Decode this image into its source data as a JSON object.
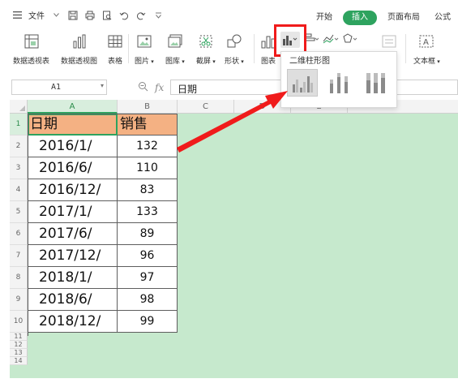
{
  "menu": {
    "file_label": "文件",
    "tabs": [
      {
        "label": "开始",
        "active": false
      },
      {
        "label": "插入",
        "active": true
      },
      {
        "label": "页面布局",
        "active": false
      },
      {
        "label": "公式",
        "active": false
      }
    ]
  },
  "ribbon": {
    "pivot_table": "数据透视表",
    "pivot_chart": "数据透视图",
    "table": "表格",
    "picture": "图片",
    "gallery": "图库",
    "screenshot": "截屏",
    "shapes": "形状",
    "chart": "图表",
    "textbox": "文本框"
  },
  "chart_dropdown": {
    "title": "二维柱形图",
    "options": [
      "clustered-column-icon",
      "stacked-column-icon",
      "percent-stacked-column-icon"
    ],
    "selected_index": 0
  },
  "formula_bar": {
    "cell_ref": "A1",
    "fx_label": "fx",
    "value": "日期"
  },
  "columns": [
    "A",
    "B",
    "C",
    "D",
    "E"
  ],
  "rows": [
    "1",
    "2",
    "3",
    "4",
    "5",
    "6",
    "7",
    "8",
    "9",
    "10",
    "11",
    "12",
    "13",
    "14"
  ],
  "table": {
    "headers": [
      "日期",
      "销售"
    ],
    "rows": [
      [
        "2016/1/",
        "132"
      ],
      [
        "2016/6/",
        "110"
      ],
      [
        "2016/12/",
        "83"
      ],
      [
        "2017/1/",
        "133"
      ],
      [
        "2017/6/",
        "89"
      ],
      [
        "2017/12/",
        "96"
      ],
      [
        "2018/1/",
        "97"
      ],
      [
        "2018/6/",
        "98"
      ],
      [
        "2018/12/",
        "99"
      ]
    ]
  },
  "colors": {
    "sheet_background": "#c6e9cd",
    "header_fill": "#f4b183",
    "active_tab": "#2ea35f",
    "highlight": "#f01b1b"
  }
}
